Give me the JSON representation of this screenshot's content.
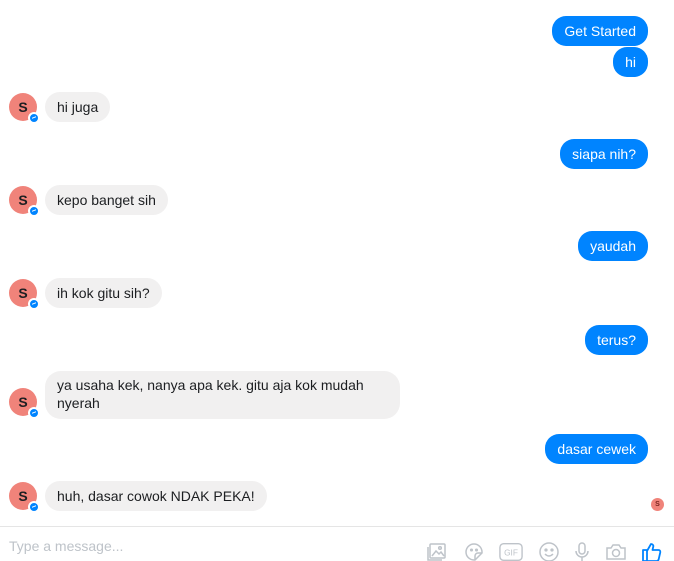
{
  "conversation": {
    "messages": [
      {
        "from": "me",
        "text": "Get Started"
      },
      {
        "from": "me",
        "text": "hi"
      },
      {
        "from": "them",
        "text": "hi juga"
      },
      {
        "from": "me",
        "text": "siapa nih?"
      },
      {
        "from": "them",
        "text": "kepo banget sih"
      },
      {
        "from": "me",
        "text": "yaudah"
      },
      {
        "from": "them",
        "text": "ih kok gitu sih?"
      },
      {
        "from": "me",
        "text": "terus?"
      },
      {
        "from": "them",
        "text": "ya usaha kek, nanya apa kek. gitu aja kok mudah\nnyerah"
      },
      {
        "from": "me",
        "text": "dasar cewek"
      },
      {
        "from": "them",
        "text": "huh, dasar cowok NDAK PEKA!"
      }
    ],
    "contact_initial": "S",
    "seen_initial": "S"
  },
  "composer": {
    "placeholder": "Type a message...",
    "icons": [
      "image-icon",
      "sticker-icon",
      "gif-icon",
      "emoji-icon",
      "microphone-icon",
      "camera-icon",
      "like-icon"
    ],
    "gif_label": "GIF"
  },
  "colors": {
    "outgoing_bubble": "#0084ff",
    "incoming_bubble": "#f1f0f0",
    "avatar": "#f0837a",
    "icon_gray": "#bec3c9"
  }
}
